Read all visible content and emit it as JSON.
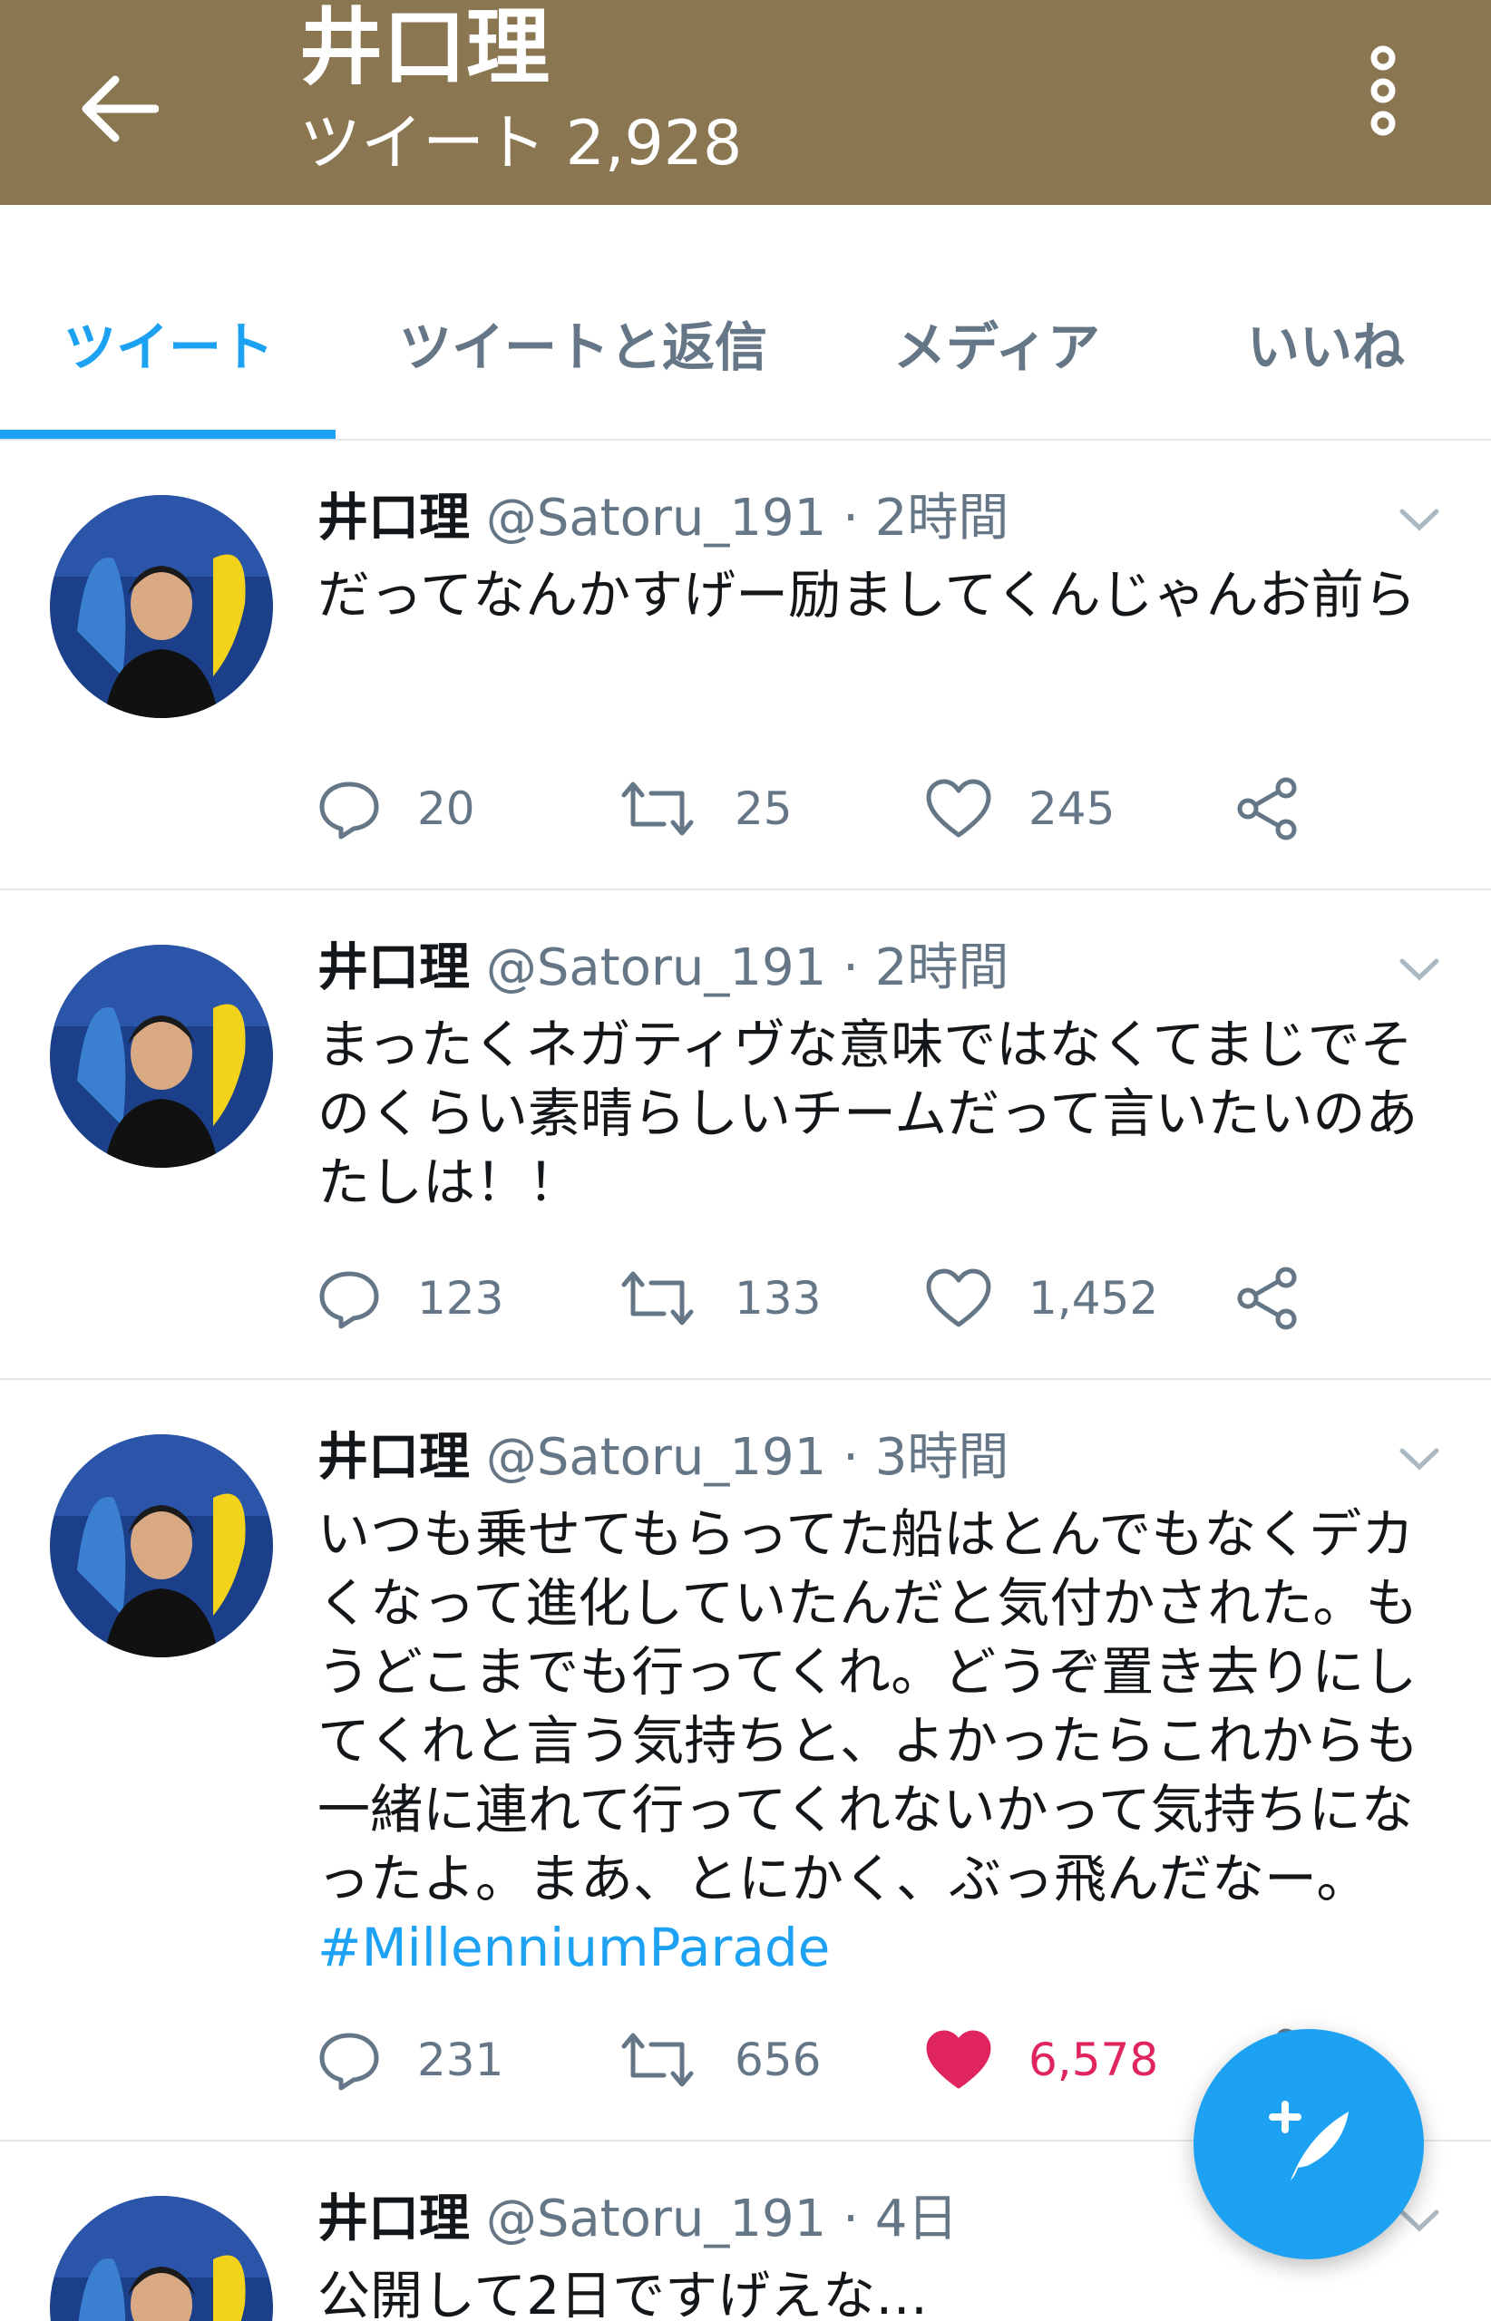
{
  "header": {
    "title": "井口理",
    "tweet_count": "ツイート 2,928",
    "bg_color": "#8a7752"
  },
  "tabs": [
    {
      "label": "ツイート",
      "active": true
    },
    {
      "label": "ツイートと返信",
      "active": false
    },
    {
      "label": "メディア",
      "active": false
    },
    {
      "label": "いいね",
      "active": false
    }
  ],
  "tweets": [
    {
      "name": "井口理",
      "handle": "@Satoru_191",
      "time": "· 2時間",
      "text": "だってなんかすげー励ましてくんじゃんお前ら",
      "hashtag": "",
      "replies": "20",
      "retweets": "25",
      "likes": "245",
      "liked": false
    },
    {
      "name": "井口理",
      "handle": "@Satoru_191",
      "time": "· 2時間",
      "text": "まったくネガティヴな意味ではなくてまじでそのくらい素晴らしいチームだって言いたいのあたしは！！",
      "hashtag": "",
      "replies": "123",
      "retweets": "133",
      "likes": "1,452",
      "liked": false
    },
    {
      "name": "井口理",
      "handle": "@Satoru_191",
      "time": "· 3時間",
      "text": "いつも乗せてもらってた船はとんでもなくデカくなって進化していたんだと気付かされた。もうどこまでも行ってくれ。どうぞ置き去りにしてくれと言う気持ちと、よかったらこれからも一緒に連れて行ってくれないかって気持ちになったよ。まあ、とにかく、ぶっ飛んだなー。",
      "hashtag": "#MillenniumParade",
      "replies": "231",
      "retweets": "656",
      "likes": "6,578",
      "liked": true
    },
    {
      "name": "井口理",
      "handle": "@Satoru_191",
      "time": "· 4日",
      "text": "公開して2日ですげえな…",
      "hashtag": "",
      "replies": "",
      "retweets": "",
      "likes": "",
      "liked": false
    }
  ],
  "icons": {
    "back": "arrow-left-icon",
    "more": "more-vertical-icon",
    "reply": "reply-icon",
    "retweet": "retweet-icon",
    "like": "heart-icon",
    "share": "share-icon",
    "compose": "compose-tweet-icon"
  },
  "colors": {
    "accent": "#1da1f2",
    "like": "#e0245e",
    "muted": "#657786"
  }
}
